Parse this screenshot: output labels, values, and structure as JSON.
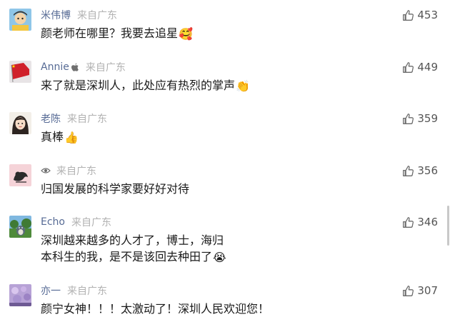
{
  "comments": [
    {
      "user": "米伟博",
      "user_icon": "",
      "origin": "来自广东",
      "lines": [
        "颜老师在哪里？我要去追星"
      ],
      "emoji": "🥰",
      "likes": "453",
      "avatar": "cartoon-boy"
    },
    {
      "user": "Annie",
      "user_icon": "apple-device-icon",
      "origin": "来自广东",
      "lines": [
        "来了就是深圳人，此处应有热烈的掌声"
      ],
      "emoji": "👏",
      "likes": "449",
      "avatar": "flag"
    },
    {
      "user": "老陈",
      "user_icon": "",
      "origin": "来自广东",
      "lines": [
        "真棒"
      ],
      "emoji": "👍",
      "likes": "359",
      "avatar": "girl-portrait"
    },
    {
      "user": "",
      "user_icon": "eye-icon",
      "origin": "来自广东",
      "lines": [
        "归国发展的科学家要好好对待"
      ],
      "emoji": "",
      "likes": "356",
      "avatar": "ink-sketch"
    },
    {
      "user": "Echo",
      "user_icon": "",
      "origin": "来自广东",
      "lines": [
        "深圳越来越多的人才了，博士，海归",
        "本科生的我，是不是该回去种田了"
      ],
      "emoji": "😭",
      "likes": "346",
      "avatar": "forest-totoro"
    },
    {
      "user": "亦一",
      "user_icon": "",
      "origin": "来自广东",
      "lines": [
        "颜宁女神！！！太激动了！深圳人民欢迎您！"
      ],
      "emoji": "",
      "likes": "307",
      "avatar": "purple-flowers"
    }
  ],
  "colors": {
    "username": "#576b95",
    "origin": "#b2b2b2",
    "text": "#1a1a1a",
    "like_icon": "#6b6b6b"
  }
}
